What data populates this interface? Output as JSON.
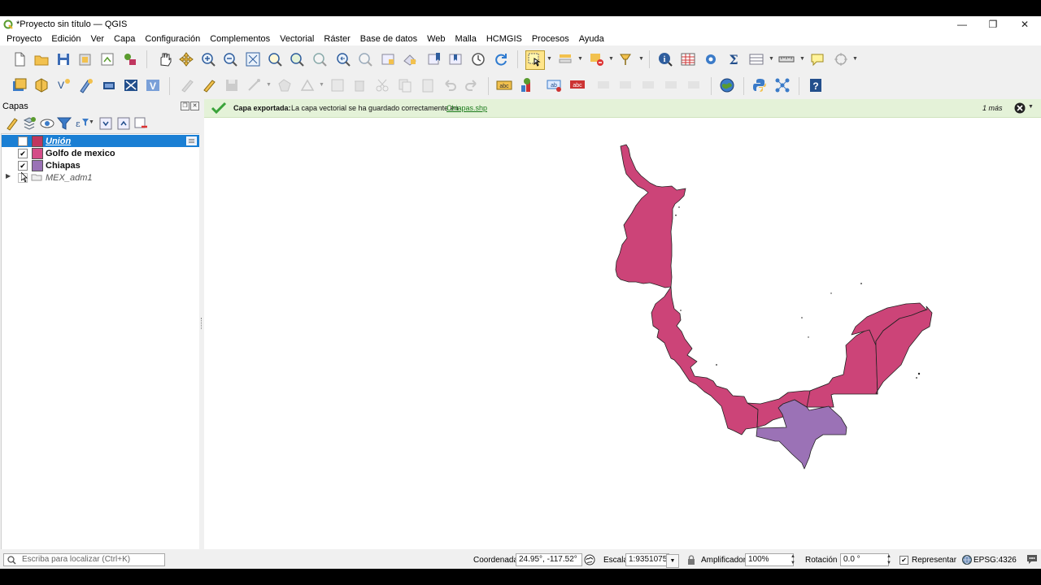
{
  "window": {
    "title": "*Proyecto sin título — QGIS",
    "controls": [
      "—",
      "❐",
      "✕"
    ]
  },
  "menu": [
    "Proyecto",
    "Edición",
    "Ver",
    "Capa",
    "Configuración",
    "Complementos",
    "Vectorial",
    "Ráster",
    "Base de datos",
    "Web",
    "Malla",
    "HCMGIS",
    "Procesos",
    "Ayuda"
  ],
  "layers_panel": {
    "title": "Capas",
    "layers": [
      {
        "name": "Unión",
        "checked": false,
        "color": "#c0365f",
        "selected": true,
        "style": "italic-underline"
      },
      {
        "name": "Golfo de mexico",
        "checked": true,
        "color": "#d44c88",
        "selected": false,
        "style": "bold"
      },
      {
        "name": "Chiapas",
        "checked": true,
        "color": "#9a72b6",
        "selected": false,
        "style": "bold"
      },
      {
        "name": "MEX_adm1",
        "checked": false,
        "color": "",
        "selected": false,
        "style": "italic",
        "group": true
      }
    ]
  },
  "message": {
    "title": "Capa exportada:",
    "text": "La capa vectorial se ha guardado correctamente en",
    "link": "Chiapas.shp",
    "more": "1 más"
  },
  "status": {
    "search_placeholder": "Escriba para localizar (Ctrl+K)",
    "coordinate_label": "Coordenada",
    "coordinate_value": "24.95°, -117.52°",
    "scale_label": "Escala",
    "scale_value": "1:9351075",
    "magnifier_label": "Amplificador",
    "magnifier_value": "100%",
    "rotation_label": "Rotación",
    "rotation_value": "0.0 °",
    "render_label": "Representar",
    "render_checked": true,
    "crs": "EPSG:4326"
  },
  "colors": {
    "union_fill": "#cc4478",
    "chiapas_fill": "#9b72b6",
    "selected_row": "#1a7fd4",
    "message_bg": "#e4f2d8"
  }
}
